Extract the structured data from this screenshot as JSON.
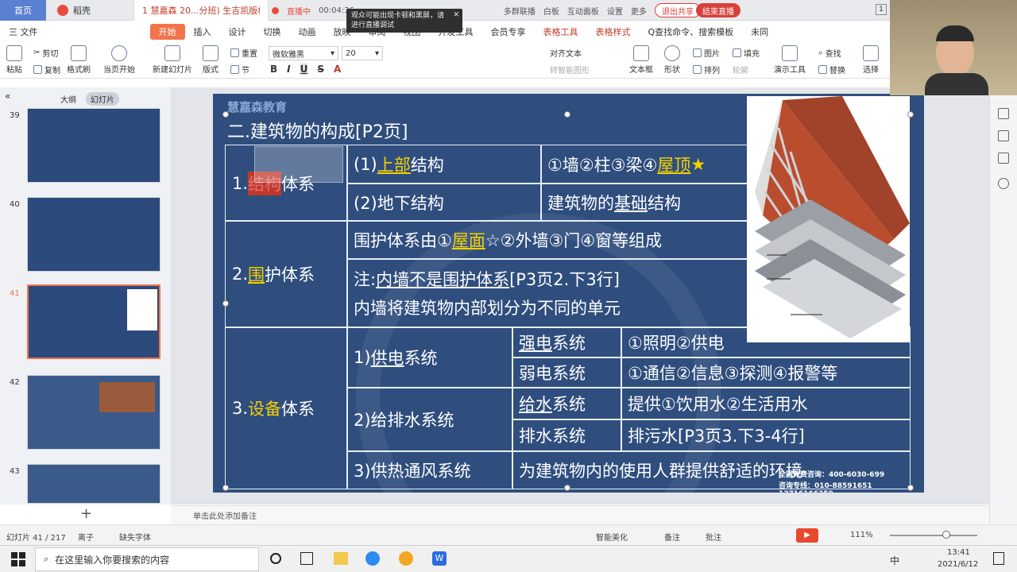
{
  "titlebar": {
    "home_tab": "首页",
    "docer_tab": "稻壳",
    "doc_tab": "1 慧嘉森 20...分班)  生吉凯版权",
    "live_status": "直播中",
    "live_timer": "00:04:36",
    "live_items": [
      "多群联播",
      "白板",
      "互动面板",
      "设置",
      "更多"
    ],
    "popup_line1": "观众可能出现卡顿和黑屏，请",
    "popup_line2": "进行直播调试",
    "btn_exit": "退出共享",
    "btn_end": "结束直播",
    "page_badge": "1"
  },
  "menu": {
    "file": "三 文件",
    "items": [
      "开始",
      "插入",
      "设计",
      "切换",
      "动画",
      "放映",
      "审阅",
      "视图",
      "开发工具",
      "会员专享",
      "表格工具",
      "表格样式"
    ],
    "active_index": 0,
    "search": "Q查找命令、搜索模板",
    "cloud": "未同"
  },
  "ribbon": {
    "paste": "粘贴",
    "cut": "剪切",
    "copy": "复制",
    "format_painter": "格式刷",
    "play_from_current": "当页开始",
    "new_slide": "新建幻灯片",
    "layout": "版式",
    "section": "节",
    "reset": "重置",
    "font_name": "微软雅黑",
    "font_size": "20",
    "text_direction": "对齐文本",
    "smart_shape": "转智能图形",
    "textbox": "文本框",
    "shape": "形状",
    "picture": "图片",
    "fill": "填充",
    "arrange": "排列",
    "outline": "轮廓",
    "presenter": "演示工具",
    "find": "查找",
    "replace": "替换",
    "select": "选择"
  },
  "sidebar": {
    "tab_outline": "大纲",
    "tab_slides": "幻灯片",
    "slide_numbers": [
      "39",
      "40",
      "41",
      "42",
      "43"
    ],
    "selected": "41"
  },
  "slide": {
    "logo_text": "慧嘉森教育",
    "title": "二.建筑物的构成[P2页]",
    "row1_label_a": "1.",
    "row1_label_b": "结构",
    "row1_label_c": "体系",
    "row1_sub1": "(1)",
    "row1_sub1_u": "上部",
    "row1_sub1_b": "结构",
    "row1_sub1_val_a": "①墙②柱③梁④",
    "row1_sub1_val_u": "屋顶",
    "row1_sub1_val_star": "★",
    "row1_sub2": "(2)地下结构",
    "row1_sub2_val_a": "建筑物的",
    "row1_sub2_val_u": "基础",
    "row1_sub2_val_b": "结构",
    "row2_label_a": "2.",
    "row2_label_u": "围",
    "row2_label_b": "护体系",
    "row2_line1_a": "围护体系由①",
    "row2_line1_u": "屋面",
    "row2_line1_b": "☆②外墙③门④窗等组成",
    "row2_line2_a": "注:",
    "row2_line2_u": "内墙不是围护体系",
    "row2_line2_b": "[P3页2.下3行]",
    "row2_line3": "内墙将建筑物内部划分为不同的单元",
    "row3_label_a": "3.",
    "row3_label_y": "设备",
    "row3_label_b": "体系",
    "power_a": "1)",
    "power_u": "供电",
    "power_b": "系统",
    "strong_u": "强电",
    "strong_b": "系统",
    "strong_val": "①照明②供电",
    "weak": "弱电系统",
    "weak_val": "①通信②信息③探测④报警等",
    "water": "2)给排水系统",
    "supply_u": "给水",
    "supply_b": "系统",
    "supply_val": "提供①饮用水②生活用水",
    "drain": "排水系统",
    "drain_val": "排污水[P3页3.下3-4行]",
    "heat": "3)供热通风系统",
    "heat_val": "为建筑物内的使用人群提供舒适的环境",
    "contact1": "全国免费咨询：400-6030-699",
    "contact2": "咨询专线：010-88591651  13716166259"
  },
  "notes": {
    "placeholder": "单击此处添加备注"
  },
  "status": {
    "slide_count": "幻灯片 41 / 217",
    "theme": "离子",
    "missing_font": "缺失字体",
    "beautify": "智能美化",
    "notes_btn": "备注",
    "comment": "批注",
    "zoom": "111%"
  },
  "taskbar": {
    "search_placeholder": "在这里输入你要搜索的内容",
    "ime": "中",
    "time": "13:41",
    "date": "2021/6/12"
  }
}
